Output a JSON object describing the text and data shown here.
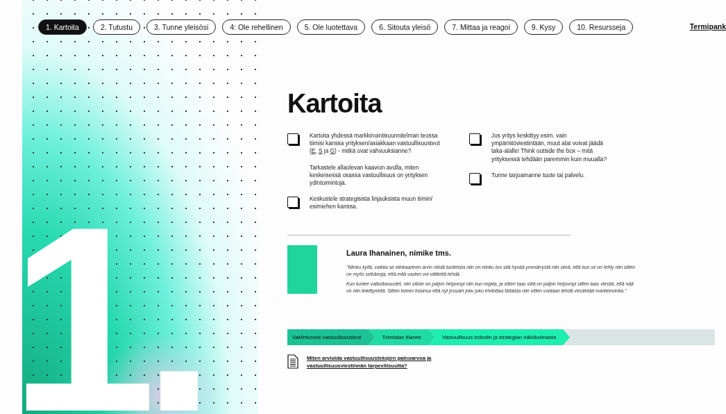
{
  "nav": {
    "tabs": [
      {
        "label": "1. Kartoita",
        "selected": true
      },
      {
        "label": "2. Tutustu",
        "selected": false
      },
      {
        "label": "3. Tunne yleisösi",
        "selected": false
      },
      {
        "label": "4: Ole rehellinen",
        "selected": false
      },
      {
        "label": "5. Ole luotettava",
        "selected": false
      },
      {
        "label": "6. Sitouta yleisö",
        "selected": false
      },
      {
        "label": "7. Mittaa ja reagoi",
        "selected": false
      },
      {
        "label": "9. Kysy",
        "selected": false
      },
      {
        "label": "10. Resursseja",
        "selected": false
      }
    ],
    "glossary_link": "Termipank"
  },
  "big_numeral": "1.",
  "title": "Kartoita",
  "checklist": {
    "columns": [
      [
        {
          "kind": "check",
          "checked": false,
          "segments": [
            {
              "text": "Kartoita yhdessä markkinointisuunnitelman teossa tiimisi kanssa yrityksen/asiakkaan vastuullisuusteot ("
            },
            {
              "text": "E",
              "link": true
            },
            {
              "text": ", "
            },
            {
              "text": "S",
              "link": true
            },
            {
              "text": " ja "
            },
            {
              "text": "G",
              "link": true
            },
            {
              "text": ") - mitkä ovat vahvuuksianne?"
            }
          ]
        },
        {
          "kind": "note",
          "segments": [
            {
              "text": "Tarkastele allaolevan kaavion avulla, miten keskeisessä osassa vastuullisuus on yrityksen ydintoimintoja."
            }
          ]
        },
        {
          "kind": "check",
          "checked": false,
          "segments": [
            {
              "text": "Keskustele strategisista linjauksista muun tiimin/ esimiehen kanssa."
            }
          ]
        }
      ],
      [
        {
          "kind": "check",
          "checked": false,
          "segments": [
            {
              "text": "Jos yritys keskittyy esim. vain ympäristöviestintään, muut alat voivat jäädä taka-alalle! Think outside the box – mitä yrityksessä tehdään paremmin kuin muualla?"
            }
          ]
        },
        {
          "kind": "check",
          "checked": false,
          "segments": [
            {
              "text": "Tunne tarjoamanne tuote tai palvelu."
            }
          ]
        }
      ]
    ]
  },
  "testimonial": {
    "name": "Laura Ihanainen, nimike tms.",
    "paragraphs": [
      "\"Niinku kyllä, vaikka se elinkaarinen arvio niistä tuotteista niin on niinku tuo sitä hyvää ymmärrystä niin siinä, että kun se on tehty niin sitten on myös selkänoja, että mitä vasten voi väitteitä tehdä.",
      "Kun tuntee vaikuttavuudet, niin silloin on paljon helpompi niin kun nojata, ja sitten taas siitä on paljon helpompi sitten taas viestiä, että nää on niin linkittyneitä. Sitten toinen toisinsa että nyt jossain joku joku ehdottaa tällaista niin sitten voidaan tehdä viestintää markkinointia.\""
    ]
  },
  "steps": [
    {
      "label": "Vakiintuneet vastuullisuusteot",
      "color": "#1cc294"
    },
    {
      "label": "Toimialan tilanne",
      "color": "#21dba4"
    },
    {
      "label": "Vastuullisuus brändin ja strategian näkökulmasta",
      "color": "#1eeeae"
    }
  ],
  "document_link": {
    "lines": [
      "Miten arvioida vastuullisuustekojen painoarvoa ja",
      "vastuullisuusviestinnän tarpeellisuutta?"
    ]
  }
}
